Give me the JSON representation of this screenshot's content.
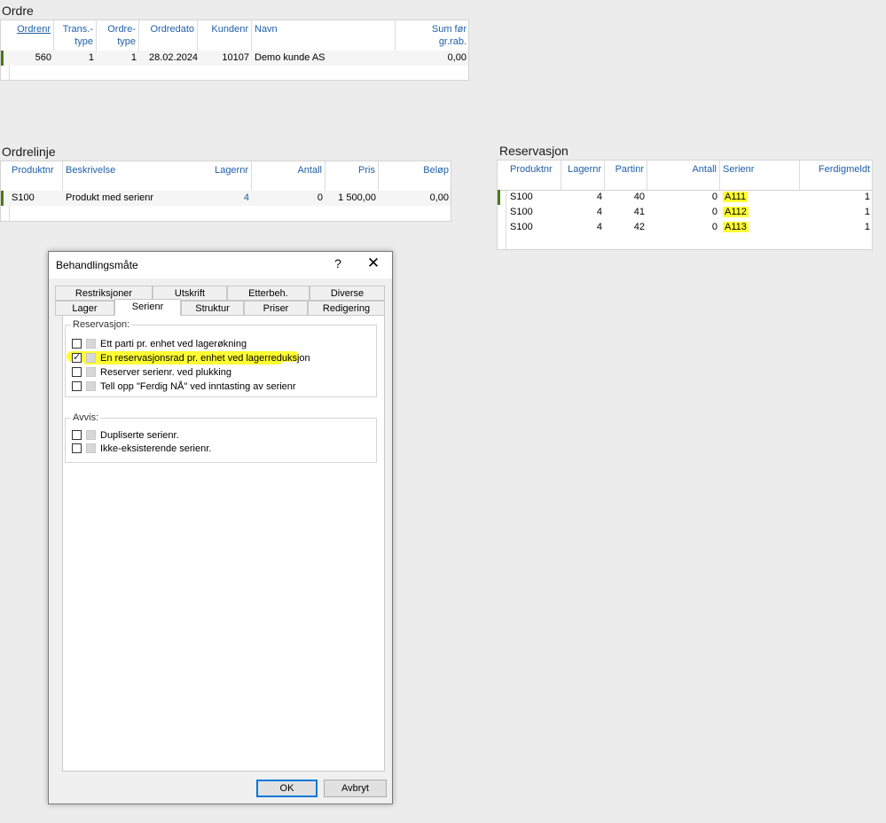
{
  "ordre": {
    "title": "Ordre",
    "headers": [
      "Ordrenr",
      "Trans.-type",
      "Ordre-type",
      "Ordredato",
      "Kundenr",
      "Navn",
      "Sum før gr.rab."
    ],
    "header_lines": [
      [
        "Ordrenr"
      ],
      [
        "Trans.-",
        "type"
      ],
      [
        "Ordre-",
        "type"
      ],
      [
        "Ordredato"
      ],
      [
        "Kundenr"
      ],
      [
        "Navn"
      ],
      [
        "Sum før",
        "gr.rab."
      ]
    ],
    "rows": [
      [
        "560",
        "1",
        "1",
        "28.02.2024",
        "10107",
        "Demo kunde AS",
        "0,00"
      ]
    ]
  },
  "ordrelinje": {
    "title": "Ordrelinje",
    "headers": [
      "Produktnr",
      "Beskrivelse",
      "Lagernr",
      "Antall",
      "Pris",
      "Beløp"
    ],
    "rows": [
      [
        "S100",
        "Produkt med serienr",
        "4",
        "0",
        "1 500,00",
        "0,00"
      ]
    ]
  },
  "reservasjon": {
    "title": "Reservasjon",
    "headers": [
      "Produktnr",
      "Lagernr",
      "Partinr",
      "Antall",
      "Serienr",
      "Ferdigmeldt"
    ],
    "rows": [
      [
        "S100",
        "4",
        "40",
        "0",
        "A111",
        "1"
      ],
      [
        "S100",
        "4",
        "41",
        "0",
        "A112",
        "1"
      ],
      [
        "S100",
        "4",
        "42",
        "0",
        "A113",
        "1"
      ]
    ]
  },
  "dialog": {
    "title": "Behandlingsmåte",
    "help": "?",
    "close": "✕",
    "tabs_row1": [
      "Restriksjoner",
      "Utskrift",
      "Etterbeh.",
      "Diverse"
    ],
    "tabs_row2": [
      "Lager",
      "Serienr",
      "Struktur",
      "Priser",
      "Redigering"
    ],
    "active_tab": "Serienr",
    "group1": {
      "label": "Reservasjon:",
      "options": [
        {
          "label": "Ett parti pr. enhet ved lagerøkning",
          "checked": false
        },
        {
          "label": "En reservasjonsrad pr. enhet ved lagerreduksjon",
          "checked": true
        },
        {
          "label": "Reserver serienr. ved plukking",
          "checked": false
        },
        {
          "label": "Tell opp \"Ferdig NÅ\" ved inntasting av serienr",
          "checked": false
        }
      ]
    },
    "group2": {
      "label": "Avvis:",
      "options": [
        {
          "label": "Dupliserte serienr.",
          "checked": false
        },
        {
          "label": "Ikke-eksisterende serienr.",
          "checked": false
        }
      ]
    },
    "ok_label": "OK",
    "cancel_label": "Avbryt"
  },
  "colors": {
    "highlight": "#ffff33",
    "link_blue": "#1f5fa8",
    "row_marker": "#4a7a1a"
  }
}
